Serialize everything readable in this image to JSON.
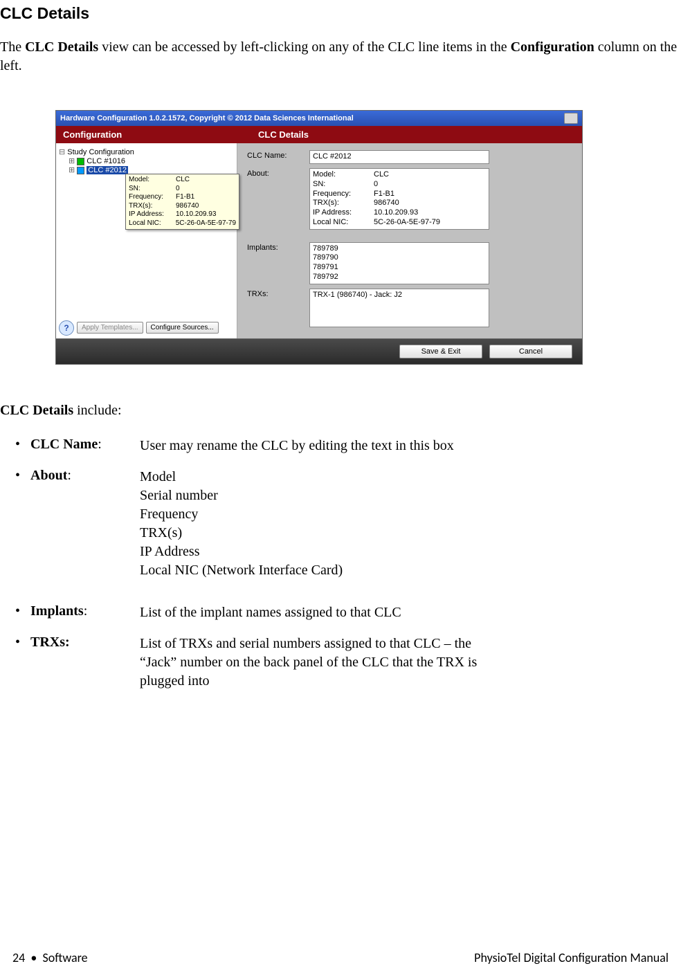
{
  "section_title": "CLC Details",
  "intro_parts": {
    "pre": "The ",
    "b1": "CLC Details",
    "mid": " view can be accessed by left-clicking on any of the CLC line items in the ",
    "b2": "Configuration",
    "post": " column on the left."
  },
  "screenshot": {
    "titlebar": "Hardware Configuration 1.0.2.1572, Copyright © 2012 Data Sciences International",
    "header_left": "Configuration",
    "header_right": "CLC Details",
    "tree": {
      "root": "Study Configuration",
      "items": [
        {
          "label": "CLC #1016",
          "dot": "green",
          "selected": false
        },
        {
          "label": "CLC #2012",
          "dot": "blue",
          "selected": true
        }
      ]
    },
    "tooltip": [
      {
        "k": "Model:",
        "v": "CLC"
      },
      {
        "k": "SN:",
        "v": "0"
      },
      {
        "k": "Frequency:",
        "v": "F1-B1"
      },
      {
        "k": "TRX(s):",
        "v": "986740"
      },
      {
        "k": "IP Address:",
        "v": "10.10.209.93"
      },
      {
        "k": "Local NIC:",
        "v": "5C-26-0A-5E-97-79"
      }
    ],
    "details": {
      "clc_name_label": "CLC Name:",
      "clc_name_value": "CLC #2012",
      "about_label": "About:",
      "about_rows": [
        {
          "k": "Model:",
          "v": "CLC"
        },
        {
          "k": "SN:",
          "v": "0"
        },
        {
          "k": "Frequency:",
          "v": "F1-B1"
        },
        {
          "k": "TRX(s):",
          "v": "986740"
        },
        {
          "k": "IP Address:",
          "v": "10.10.209.93"
        },
        {
          "k": "Local NIC:",
          "v": "5C-26-0A-5E-97-79"
        }
      ],
      "implants_label": "Implants:",
      "implants": [
        "789789",
        "789790",
        "789791",
        "789792"
      ],
      "trxs_label": "TRXs:",
      "trxs": [
        "TRX-1 (986740) - Jack: J2"
      ]
    },
    "buttons": {
      "apply_templates": "Apply Templates...",
      "configure_sources": "Configure Sources...",
      "save_exit": "Save & Exit",
      "cancel": "Cancel",
      "help_char": "?"
    }
  },
  "include_line": {
    "b": "CLC Details",
    "rest": " include:"
  },
  "definitions": [
    {
      "term": "CLC Name",
      "colon": ":",
      "desc": "User may rename the CLC by editing the text in this box"
    },
    {
      "term": "About",
      "colon": ":",
      "desc": "Model\nSerial number\nFrequency\nTRX(s)\nIP Address\nLocal NIC (Network Interface Card)"
    },
    {
      "term": "Implants",
      "colon": ":",
      "desc": "List of the implant names assigned to that CLC"
    },
    {
      "term": "TRXs:",
      "colon": "",
      "desc": "List of TRXs and serial numbers assigned to that CLC – the “Jack” number on the back panel of the CLC that the TRX is plugged into"
    }
  ],
  "footer": {
    "left_page": "24",
    "left_sep": "•",
    "left_section": "Software",
    "right": "PhysioTel Digital Configuration Manual"
  }
}
